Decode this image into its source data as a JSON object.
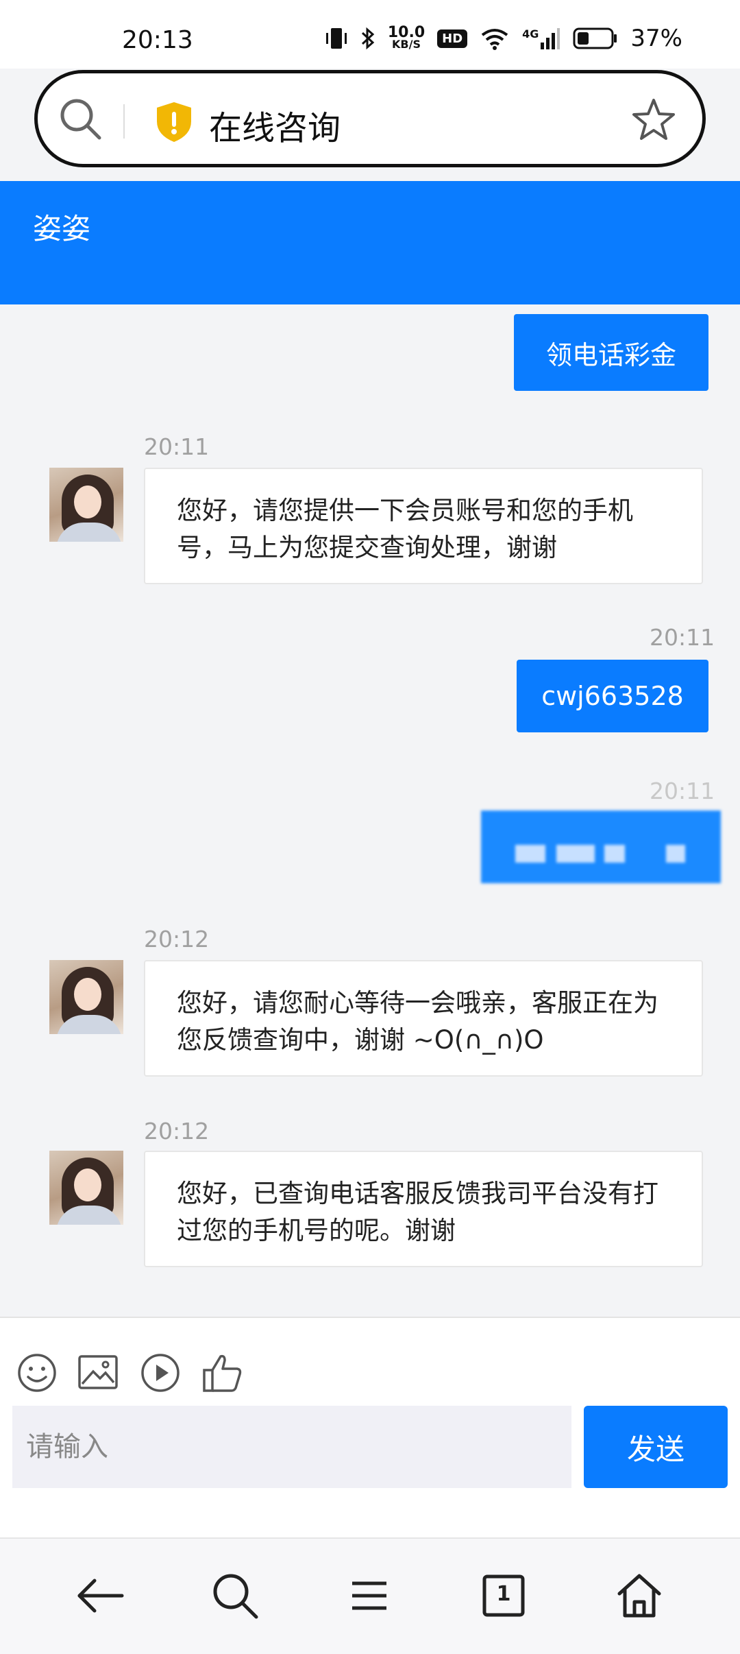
{
  "status_bar": {
    "time": "20:13",
    "net_speed_value": "10.0",
    "net_speed_unit": "KB/S",
    "hd_label": "HD",
    "network_type": "4G",
    "battery_percent": "37%"
  },
  "url_bar": {
    "title": "在线咨询"
  },
  "chat_header": {
    "agent_name": "姿姿"
  },
  "messages": [
    {
      "direction": "out",
      "text": "领电话彩金"
    },
    {
      "direction": "in",
      "time": "20:11",
      "text": "您好，请您提供一下会员账号和您的手机号，马上为您提交查询处理，谢谢"
    },
    {
      "direction": "out",
      "time": "20:11",
      "text": "cwj663528"
    },
    {
      "direction": "out",
      "time": "20:11",
      "text": "",
      "redacted": true
    },
    {
      "direction": "in",
      "time": "20:12",
      "text": "您好，请您耐心等待一会哦亲，客服正在为您反馈查询中，谢谢 ~O(∩_∩)O"
    },
    {
      "direction": "in",
      "time": "20:12",
      "text": "您好，已查询电话客服反馈我司平台没有打过您的手机号的呢。谢谢"
    }
  ],
  "composer": {
    "placeholder": "请输入",
    "send_label": "发送",
    "tools": [
      "emoji-icon",
      "image-icon",
      "video-icon",
      "thumbs-up-icon"
    ]
  },
  "bottom_nav": {
    "tab_count": "1",
    "icons": [
      "back-arrow-icon",
      "search-icon",
      "menu-icon",
      "tabs-icon",
      "home-icon"
    ]
  },
  "colors": {
    "accent": "#0a7cff",
    "background": "#f3f4f6"
  }
}
